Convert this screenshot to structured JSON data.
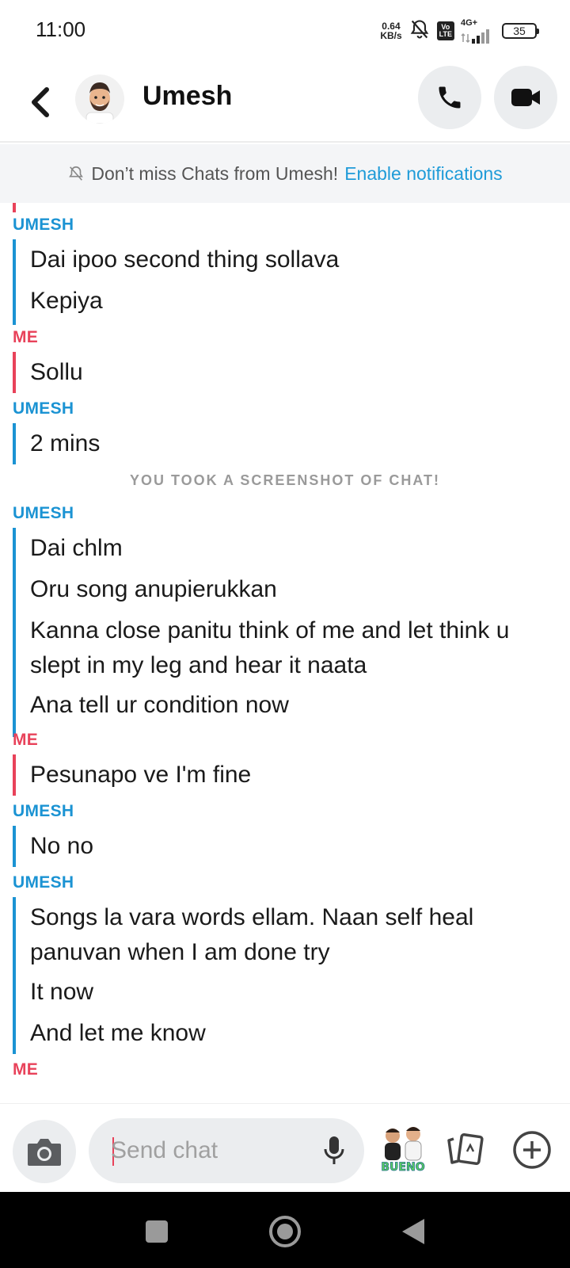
{
  "status_bar": {
    "time": "11:00",
    "net_speed_value": "0.64",
    "net_speed_unit": "KB/s",
    "volte_top": "Vo",
    "volte_bottom": "LTE",
    "network": "4G+",
    "battery": "35"
  },
  "header": {
    "contact_name": "Umesh"
  },
  "notification_banner": {
    "text": "Don’t miss Chats from Umesh!",
    "link": "Enable notifications"
  },
  "chat": {
    "labels": {
      "umesh": "UMESH",
      "me": "ME"
    },
    "system_note": "YOU TOOK A SCREENSHOT OF CHAT!",
    "messages": [
      "Dai ipoo second thing sollava",
      "Kepiya",
      "Sollu",
      "2 mins",
      "Dai chlm",
      "Oru song anupierukkan",
      "Kanna close panitu think of me and let think u slept in my leg and hear it naata",
      "Ana tell ur condition now",
      "Pesunapo ve I'm fine",
      "No no",
      "Songs la vara words ellam. Naan self heal panuvan when I am done try",
      "It now",
      "And let me know"
    ]
  },
  "input_bar": {
    "placeholder": "Send chat",
    "bitmoji_text": "BUENO"
  },
  "colors": {
    "umesh": "#1b93d3",
    "me": "#e8425a",
    "link": "#1f9bd8"
  }
}
